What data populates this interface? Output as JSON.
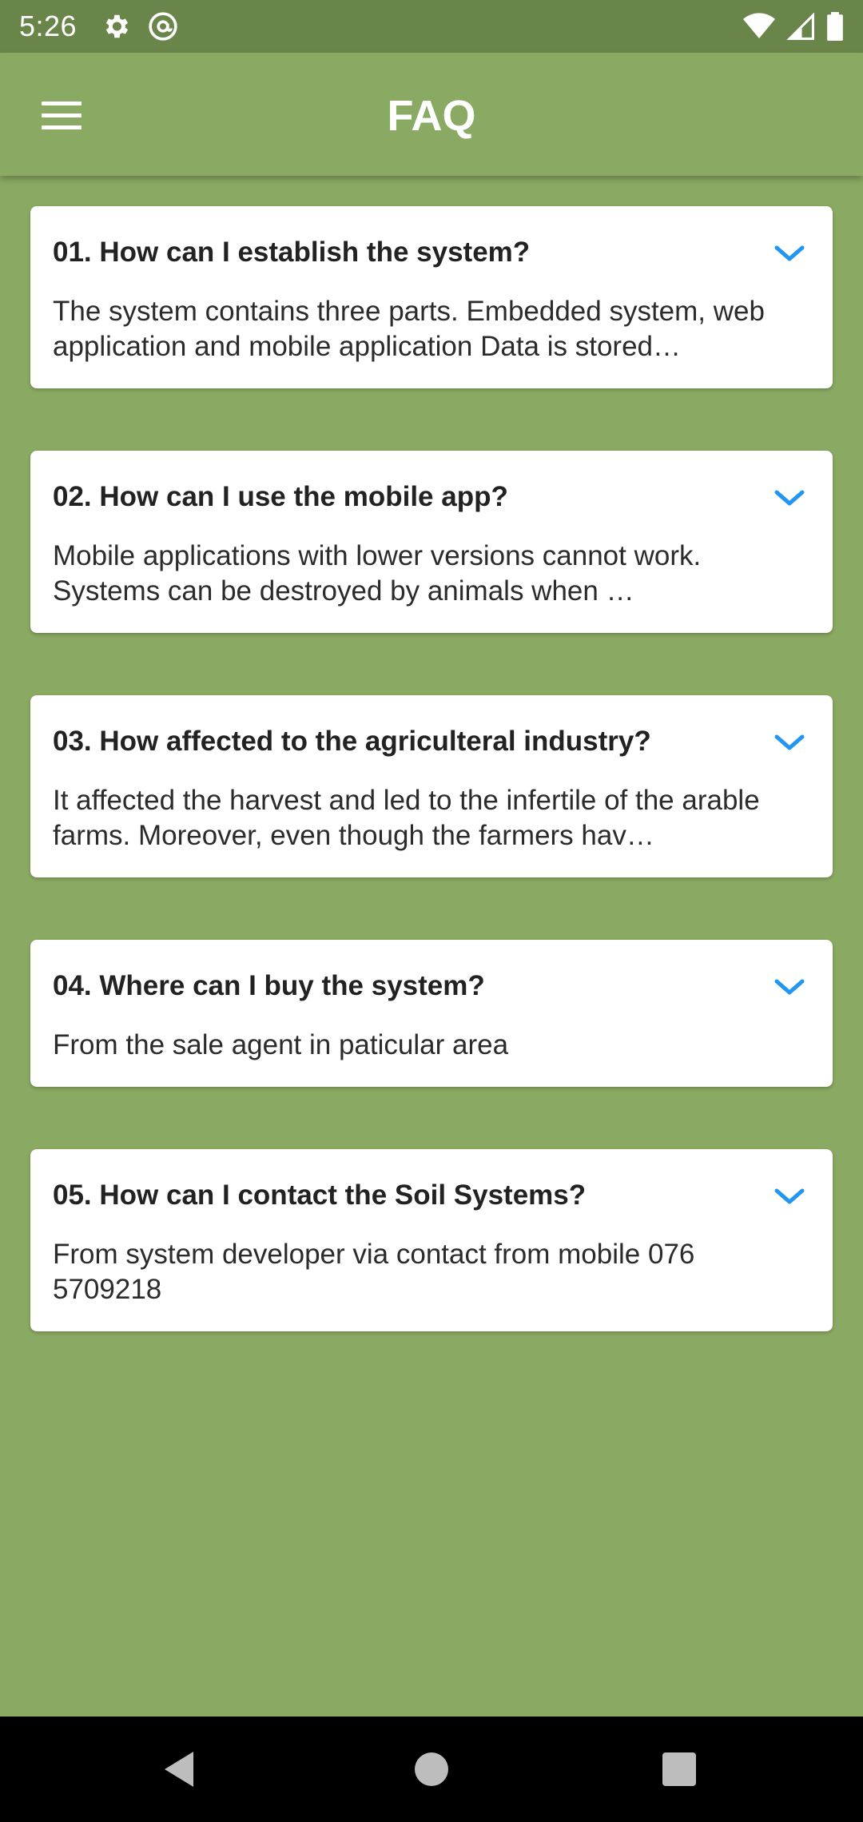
{
  "status_bar": {
    "time": "5:26",
    "icons_left": [
      "gear-icon",
      "at-sign-icon"
    ],
    "icons_right": [
      "wifi-icon",
      "signal-icon",
      "battery-icon"
    ]
  },
  "app_bar": {
    "title": "FAQ",
    "menu_icon": "hamburger-menu-icon"
  },
  "faq": [
    {
      "question": "01. How can I establish the system?",
      "answer": "The system contains three parts. Embedded system, web application and mobile application Data is stored…"
    },
    {
      "question": "02. How can I use the mobile app?",
      "answer": "Mobile applications with lower versions cannot work. Systems can be destroyed by animals when …"
    },
    {
      "question": "03. How affected to the agriculteral industry?",
      "answer": "It affected the harvest and led to the infertile of the arable farms. Moreover, even though the farmers hav…"
    },
    {
      "question": "04. Where can I buy the system?",
      "answer": "From the sale agent in paticular area"
    },
    {
      "question": "05. How can I contact the Soil Systems?",
      "answer": "From system developer via contact from mobile 076 5709218"
    }
  ],
  "colors": {
    "background": "#8aa962",
    "status_bar": "#6a8549",
    "chevron": "#2196f3"
  },
  "nav_bar": {
    "icons": [
      "back-icon",
      "home-icon",
      "recents-icon"
    ]
  }
}
